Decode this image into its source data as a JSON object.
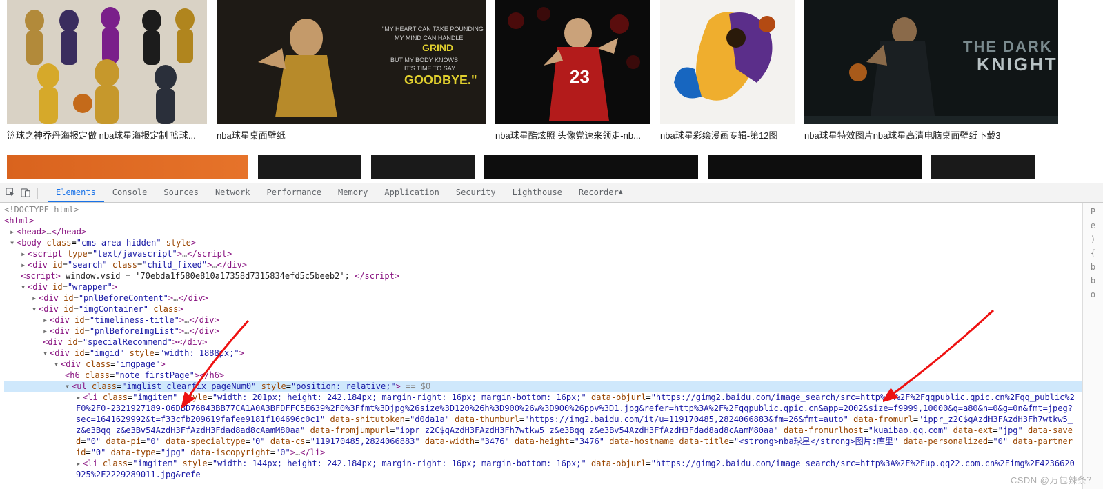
{
  "results": {
    "row1": [
      {
        "caption": "篮球之神乔丹海报定做 nba球星海报定制 篮球..."
      },
      {
        "caption": "nba球星桌面壁纸"
      },
      {
        "caption": "nba球星酷炫照 头像党速来领走-nb..."
      },
      {
        "caption": "nba球星彩绘漫画专辑-第12图"
      },
      {
        "caption": "nba球星特效图片nba球星高清电脑桌面壁纸下载3"
      }
    ]
  },
  "devtools": {
    "tabs": [
      "Elements",
      "Console",
      "Sources",
      "Network",
      "Performance",
      "Memory",
      "Application",
      "Security",
      "Lighthouse",
      "Recorder"
    ],
    "active_tab": "Elements",
    "side_letters": [
      "P",
      "e",
      ")",
      "{",
      "b",
      "b",
      "o"
    ],
    "dom": {
      "doctype": "<!DOCTYPE html>",
      "html_open": "<html>",
      "head": "<head>…</head>",
      "body_open_pre": "<body class=",
      "body_class": "cms-area-hidden",
      "body_open_post": " style>",
      "script1": "<script type=\"text/javascript\">…</scr",
      "script1_end": "ipt>",
      "search_div": "<div id=\"search\" class=\"child_fixed\">…</div>",
      "vsid_pre": "<script> window.vsid = '",
      "vsid_val": "70ebda1f580e810a17358d7315834efd5c5beeb2",
      "vsid_post": "'; </scr",
      "vsid_post2": "ipt>",
      "wrapper": "<div id=\"wrapper\">",
      "pnlbefore": "<div id=\"pnlBeforeContent\">…</div>",
      "imgcontainer": "<div id=\"imgContainer\" class>",
      "timeliness": "<div id=\"timeliness-title\">…</div>",
      "pnlbeforeimg": "<div id=\"pnlBeforeImgList\">…</div>",
      "specialrec": "<div id=\"specialRecommend\"></div>",
      "imgid_pre": "<div id=\"imgid\" style=\"",
      "imgid_style": "width: 1888px;",
      "imgid_post": "\">",
      "imgpage": "<div class=\"imgpage\">",
      "h6": "<h6 class=\"note firstPage\"></h6>",
      "ul_pre": "<ul class=\"",
      "ul_class": "imglist clearfix pageNum0",
      "ul_mid": "\" style=\"",
      "ul_style": "position: relative;",
      "ul_post": "\">",
      "ul_eq": " == $0",
      "li1_a": "<li class=\"imgitem\" style=\"width: 201px; height: 242.184px; margin-right: 16px; margin-bottom: 16px;\" data-objurl=\"https://gimg2.baidu.com/image_search/src=http%3A%2F%2Fqqpublic.qpic.cn%2Fqq_public%2F0%2F0-2321927189-06DBD76",
      "li1_b": "843BB77CA1A0A3BFDFFC5E639%2F0%3Ffmt%3Djpg%26size%3D120%26h%3D900%26w%3D900%26ppv%3D1.jpg&refer=http%3A%2F%2Fqqpublic.qpic.cn&app=2002&size=f9999,10000&q=a80&n=0&g=0n&fmt=jpeg?sec=1641629992&t=f33cfb209619fafee9181f104696c0c1\"",
      "li1_c": "data-shitutoken=\"d0da1a\" data-thumburl=\"https://img2.baidu.com/it/u=119170485,2824066883&fm=26&fmt=auto\" data-fromurl=\"ippr_z2C$qAzdH3FAzdH3Fh7wtkw5_z&e3Bqq_z&e3Bv54AzdH3FfAzdH3Fdad8ad8cAamM80aa\" data-fromjumpurl=\"ippr_z2C$qA",
      "li1_d": "zdH3FAzdH3Fh7wtkw5_z&e3Bqq_z&e3Bv54AzdH3FfAzdH3Fdad8ad8cAamM80aa\" data-fromurlhost=\"kuaibao.qq.com\" data-ext=\"jpg\" data-saved=\"0\" data-pi=\"0\" data-specialtype=\"0\" data-cs=\"119170485,2824066883\" data-width=\"3476\" data-height=",
      "li1_e": "\"3476\" data-hostname data-title=\"<strong>nba球星</strong>图片:库里\" data-personalized=\"0\" data-partnerid=\"0\" data-type=\"jpg\" data-iscopyright=\"0\">…</li>",
      "li2": "<li class=\"imgitem\" style=\"width: 144px; height: 242.184px; margin-right: 16px; margin-bottom: 16px;\" data-objurl=\"https://gimg2.baidu.com/image_search/src=http%3A%2F%2Fup.qq22.com.cn%2Fimg%2F4236620925%2F2229289011.jpg&refe"
    }
  },
  "watermark": "CSDN @万包辣条？"
}
